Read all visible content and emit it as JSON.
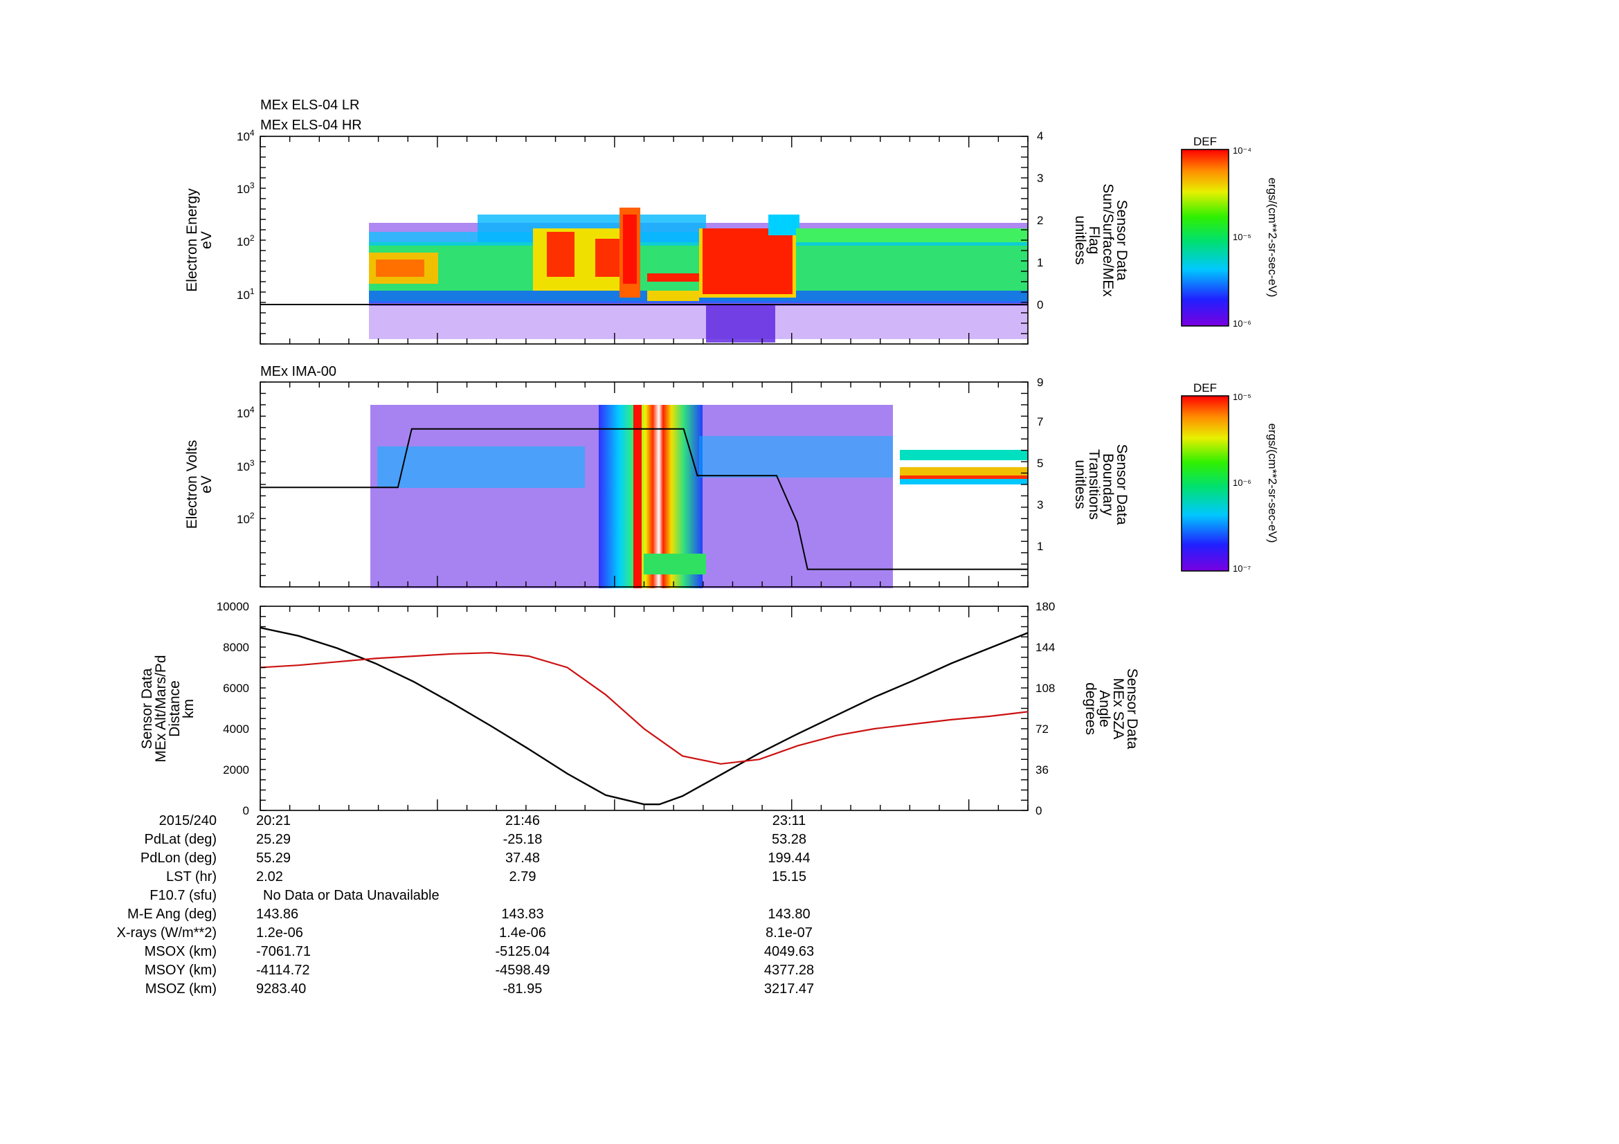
{
  "colors": {
    "axes": "#000000",
    "altitude_line": "#000000",
    "sza_line": "#cc1111",
    "sza_label": "#cc1111"
  },
  "panel1": {
    "title_lr": "MEx ELS-04 LR",
    "title_hr": "MEx ELS-04 HR",
    "ylabel_1": "Electron Energy",
    "ylabel_2": "eV",
    "rlabel": [
      "Sensor Data",
      "Sun/Surface/MEx",
      "Flag",
      "unitless"
    ],
    "colorbar": {
      "title": "DEF",
      "top": "10⁻⁴",
      "mid": "10⁻⁵",
      "bottom": "10⁻⁶",
      "units": "ergs/(cm**2-sr-sec-eV)"
    }
  },
  "panel2": {
    "title": "MEx IMA-00",
    "ylabel_1": "Electron Volts",
    "ylabel_2": "eV",
    "rlabel": [
      "Sensor Data",
      "Boundary",
      "Transitions",
      "unitless"
    ],
    "colorbar": {
      "title": "DEF",
      "top": "10⁻⁵",
      "mid": "10⁻⁶",
      "bottom": "10⁻⁷",
      "units": "ergs/(cm**2-sr-sec-eV)"
    }
  },
  "panel3": {
    "ylabel": [
      "Sensor Data",
      "MEx Alt/Mars/Pd",
      "Distance",
      "km"
    ],
    "rlabel": [
      "Sensor Data",
      "MEx SZA",
      "Angle",
      "degrees"
    ]
  },
  "info_table": {
    "rows": [
      {
        "label": "2015/240",
        "v1": "20:21",
        "v2": "21:46",
        "v3": "23:11"
      },
      {
        "label": "PdLat (deg)",
        "v1": "25.29",
        "v2": "-25.18",
        "v3": "53.28"
      },
      {
        "label": "PdLon (deg)",
        "v1": "55.29",
        "v2": "37.48",
        "v3": "199.44"
      },
      {
        "label": "LST (hr)",
        "v1": "2.02",
        "v2": "2.79",
        "v3": "15.15"
      },
      {
        "label": "F10.7 (sfu)",
        "v1": "No Data or Data Unavailable",
        "v2": "",
        "v3": ""
      },
      {
        "label": "M-E Ang (deg)",
        "v1": "143.86",
        "v2": "143.83",
        "v3": "143.80"
      },
      {
        "label": "X-rays (W/m**2)",
        "v1": "1.2e-06",
        "v2": "1.4e-06",
        "v3": "8.1e-07"
      },
      {
        "label": "MSOX (km)",
        "v1": "-7061.71",
        "v2": "-5125.04",
        "v3": "4049.63"
      },
      {
        "label": "MSOY (km)",
        "v1": "-4114.72",
        "v2": "-4598.49",
        "v3": "4377.28"
      },
      {
        "label": "MSOZ (km)",
        "v1": "9283.40",
        "v2": "-81.95",
        "v3": "3217.47"
      }
    ]
  },
  "chart_data": [
    {
      "type": "heatmap",
      "panel": "MEx ELS-04 LR / MEx ELS-04 HR",
      "ylabel": "Electron Energy eV",
      "y_scale": "log",
      "ylim": [
        2,
        10000
      ],
      "y_ticks": [
        "10¹",
        "10²",
        "10³",
        "10⁴"
      ],
      "y_right": {
        "label": "Sensor Data Sun/Surface/MEx Flag unitless",
        "ticks": [
          0,
          1,
          2,
          3,
          4
        ]
      },
      "x_time_range": [
        "20:21",
        "00:04"
      ],
      "flag_series": {
        "values": [
          0,
          0
        ]
      },
      "colorbar": {
        "label": "DEF",
        "range": [
          1e-06,
          0.0001
        ],
        "units": "ergs/(cm**2-sr-sec-eV)"
      }
    },
    {
      "type": "heatmap",
      "panel": "MEx IMA-00",
      "ylabel": "Electron Volts eV",
      "y_scale": "log",
      "ylim": [
        20,
        30000
      ],
      "y_ticks": [
        "10²",
        "10³",
        "10⁴"
      ],
      "y_right": {
        "label": "Sensor Data Boundary Transitions unitless",
        "ticks": [
          1,
          3,
          5,
          7,
          9
        ]
      },
      "x_time_range": [
        "20:21",
        "00:04"
      ],
      "boundary_series": {
        "x": [
          "20:21",
          "21:01",
          "21:05",
          "22:24",
          "22:28",
          "22:51",
          "22:54",
          "22:57",
          "23:00",
          "00:04"
        ],
        "values": [
          4.5,
          4.5,
          7,
          7,
          5,
          5,
          4,
          3,
          1,
          1
        ]
      },
      "colorbar": {
        "label": "DEF",
        "range": [
          1e-07,
          1e-05
        ],
        "units": "ergs/(cm**2-sr-sec-eV)"
      }
    },
    {
      "type": "line",
      "panel": "Distance / SZA",
      "ylabel": "Sensor Data MEx Alt/Mars/Pd Distance km",
      "ylim": [
        0,
        10000
      ],
      "y_right_label": "Sensor Data MEx SZA Angle degrees",
      "y_right_lim": [
        0,
        180
      ],
      "y_ticks": [
        0,
        2000,
        4000,
        6000,
        8000,
        10000
      ],
      "y_right_ticks": [
        0,
        36,
        72,
        108,
        144,
        180
      ],
      "x_labels": [
        "20:21",
        "21:46",
        "23:11"
      ],
      "series": [
        {
          "name": "MEx Alt/Mars/Pd",
          "axis": "left",
          "x": [
            0,
            0.05,
            0.1,
            0.15,
            0.2,
            0.25,
            0.3,
            0.35,
            0.4,
            0.45,
            0.5,
            0.52,
            0.55,
            0.6,
            0.65,
            0.7,
            0.75,
            0.8,
            0.85,
            0.9,
            0.95,
            1.0
          ],
          "values": [
            8950,
            8550,
            7950,
            7200,
            6300,
            5250,
            4150,
            3000,
            1800,
            750,
            300,
            300,
            700,
            1750,
            2800,
            3750,
            4650,
            5550,
            6350,
            7200,
            7950,
            8700
          ]
        },
        {
          "name": "MEx SZA",
          "axis": "right",
          "x": [
            0,
            0.05,
            0.1,
            0.15,
            0.2,
            0.25,
            0.3,
            0.35,
            0.4,
            0.45,
            0.5,
            0.55,
            0.6,
            0.65,
            0.7,
            0.75,
            0.8,
            0.85,
            0.9,
            0.95,
            1.0
          ],
          "values": [
            126,
            128,
            131,
            134,
            136,
            138,
            139,
            136,
            126,
            102,
            72,
            48,
            41,
            45,
            57,
            66,
            72,
            76,
            80,
            83,
            87
          ]
        }
      ]
    }
  ]
}
